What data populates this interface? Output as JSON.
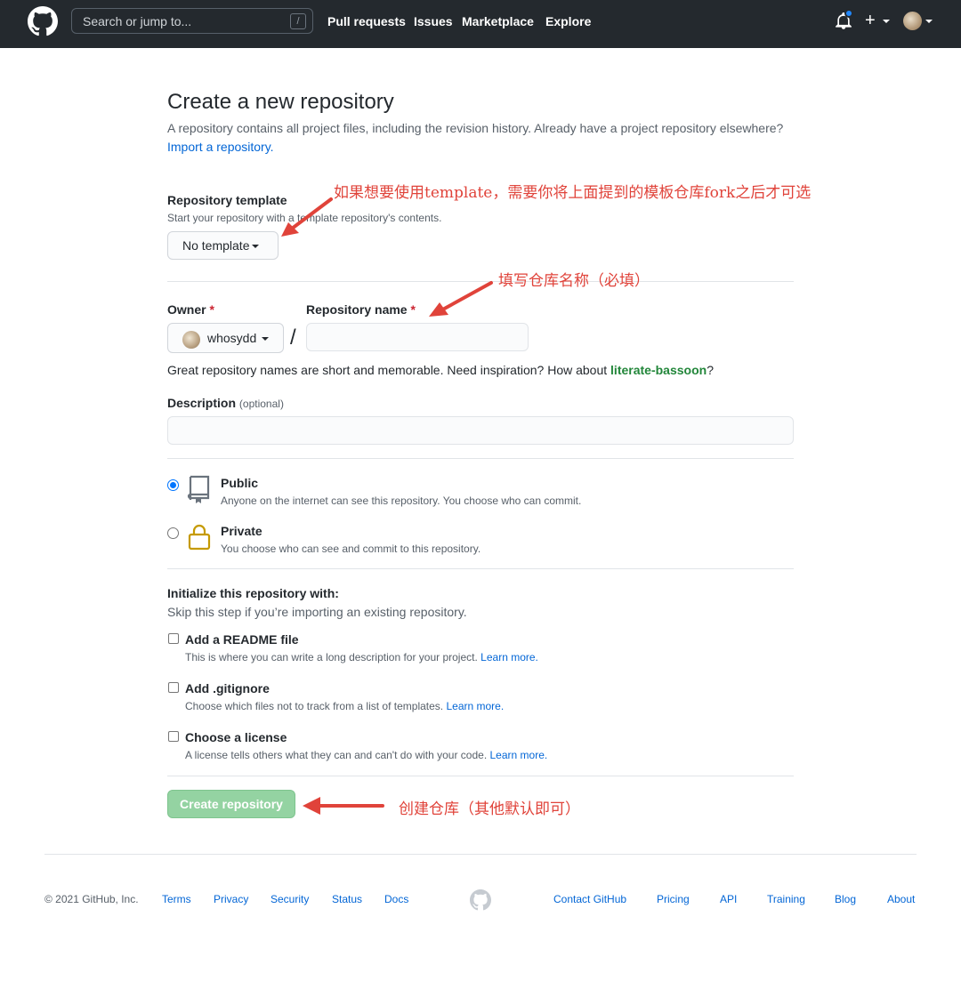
{
  "header": {
    "search_placeholder": "Search or jump to...",
    "search_key": "/",
    "nav": [
      "Pull requests",
      "Issues",
      "Marketplace",
      "Explore"
    ],
    "plus": "+"
  },
  "page": {
    "title": "Create a new repository",
    "lead_text": "A repository contains all project files, including the revision history. Already have a project repository elsewhere?",
    "import_link": "Import a repository."
  },
  "template": {
    "label": "Repository template",
    "note": "Start your repository with a template repository's contents.",
    "button": "No template"
  },
  "owner": {
    "label": "Owner",
    "required": "*",
    "value": "whosydd"
  },
  "repo_name": {
    "label": "Repository name",
    "required": "*",
    "slash": "/",
    "value": "",
    "hint_prefix": "Great repository names are short and memorable. Need inspiration? How about ",
    "suggestion": "literate-bassoon",
    "hint_suffix": "?"
  },
  "description": {
    "label": "Description",
    "optional": "(optional)",
    "value": ""
  },
  "visibility": {
    "selected": "public",
    "options": [
      {
        "title": "Public",
        "desc": "Anyone on the internet can see this repository. You choose who can commit."
      },
      {
        "title": "Private",
        "desc": "You choose who can see and commit to this repository."
      }
    ]
  },
  "init": {
    "title": "Initialize this repository with:",
    "subtitle": "Skip this step if you’re importing an existing repository.",
    "options": [
      {
        "title": "Add a README file",
        "desc": "This is where you can write a long description for your project.",
        "link": "Learn more.",
        "checked": false
      },
      {
        "title": "Add .gitignore",
        "desc": "Choose which files not to track from a list of templates.",
        "link": "Learn more.",
        "checked": false
      },
      {
        "title": "Choose a license",
        "desc": "A license tells others what they can and can't do with your code.",
        "link": "Learn more.",
        "checked": false
      }
    ]
  },
  "create_button": "Create repository",
  "annotations": {
    "template": "如果想要使用template，需要你将上面提到的模板仓库fork之后才可选",
    "name": "填写仓库名称（必填）",
    "create": "创建仓库（其他默认即可）",
    "color": "#e0433a"
  },
  "footer": {
    "copyright": "© 2021 GitHub, Inc.",
    "left_links": [
      "Terms",
      "Privacy",
      "Security",
      "Status",
      "Docs"
    ],
    "right_links": [
      "Contact GitHub",
      "Pricing",
      "API",
      "Training",
      "Blog",
      "About"
    ]
  }
}
